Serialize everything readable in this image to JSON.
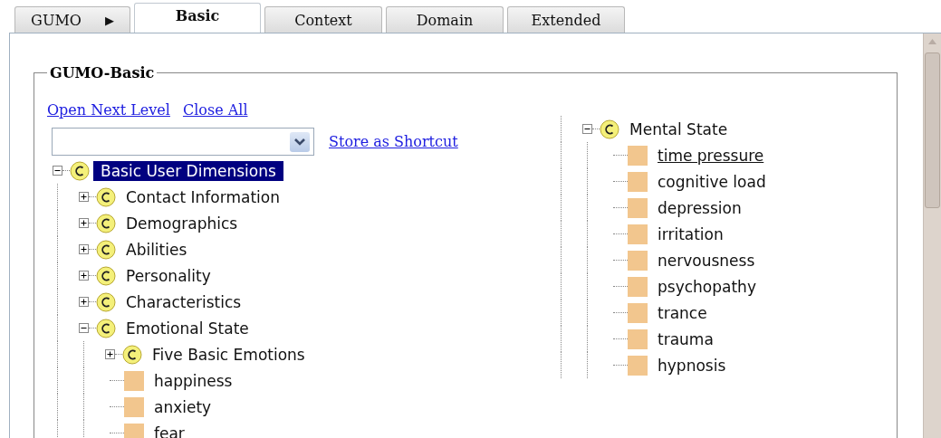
{
  "tabs": [
    {
      "label": "GUMO",
      "selected": false,
      "arrow": "▶"
    },
    {
      "label": "Basic",
      "selected": true
    },
    {
      "label": "Context",
      "selected": false
    },
    {
      "label": "Domain",
      "selected": false
    },
    {
      "label": "Extended",
      "selected": false
    }
  ],
  "section": {
    "title": "GUMO-Basic",
    "links": [
      "Open Next Level",
      "Close All"
    ],
    "store_link": "Store as Shortcut",
    "left_tree": [
      {
        "kind": "class",
        "label": "Basic User Dimensions",
        "expanded": true,
        "selected": true,
        "children": [
          {
            "kind": "class",
            "label": "Contact Information",
            "expanded": false,
            "selected": false
          },
          {
            "kind": "class",
            "label": "Demographics",
            "expanded": false,
            "selected": false
          },
          {
            "kind": "class",
            "label": "Abilities",
            "expanded": false,
            "selected": false
          },
          {
            "kind": "class",
            "label": "Personality",
            "expanded": false,
            "selected": false
          },
          {
            "kind": "class",
            "label": "Characteristics",
            "expanded": false,
            "selected": false
          },
          {
            "kind": "class",
            "label": "Emotional State",
            "expanded": true,
            "selected": false,
            "children": [
              {
                "kind": "class",
                "label": "Five Basic Emotions",
                "expanded": false,
                "selected": false
              },
              {
                "kind": "instance",
                "label": "happiness",
                "selected": false
              },
              {
                "kind": "instance",
                "label": "anxiety",
                "selected": false
              },
              {
                "kind": "instance",
                "label": "fear",
                "selected": false
              }
            ]
          }
        ]
      }
    ],
    "right_tree": [
      {
        "kind": "class",
        "label": "Mental State",
        "expanded": true,
        "selected": false,
        "children": [
          {
            "kind": "instance",
            "label": "time pressure",
            "selected": false,
            "hovered": true
          },
          {
            "kind": "instance",
            "label": "cognitive load",
            "selected": false
          },
          {
            "kind": "instance",
            "label": "depression",
            "selected": false
          },
          {
            "kind": "instance",
            "label": "irritation",
            "selected": false
          },
          {
            "kind": "instance",
            "label": "nervousness",
            "selected": false
          },
          {
            "kind": "instance",
            "label": "psychopathy",
            "selected": false
          },
          {
            "kind": "instance",
            "label": "trance",
            "selected": false
          },
          {
            "kind": "instance",
            "label": "trauma",
            "selected": false
          },
          {
            "kind": "instance",
            "label": "hypnosis",
            "selected": false
          }
        ]
      }
    ]
  }
}
